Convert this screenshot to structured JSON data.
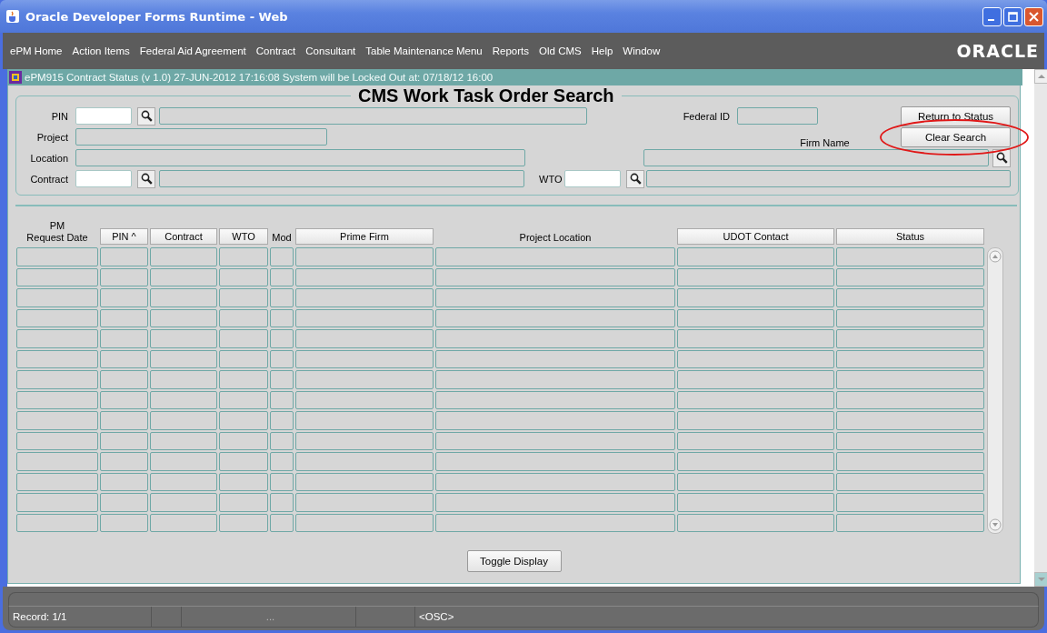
{
  "window": {
    "title": "Oracle Developer Forms Runtime - Web"
  },
  "menu": [
    {
      "label": "ePM Home"
    },
    {
      "label": "Action Items"
    },
    {
      "label": "Federal Aid Agreement"
    },
    {
      "label": "Contract"
    },
    {
      "label": "Consultant"
    },
    {
      "label": "Table Maintenance Menu"
    },
    {
      "label": "Reports"
    },
    {
      "label": "Old CMS"
    },
    {
      "label": "Help"
    },
    {
      "label": "Window"
    }
  ],
  "brand": "ORACLE",
  "form": {
    "title": "ePM915 Contract Status (v 1.0) 27-JUN-2012 17:16:08 System will be Locked Out at: 07/18/12 16:00",
    "heading": "CMS Work Task Order Search"
  },
  "search": {
    "pin": {
      "label": "PIN"
    },
    "project": {
      "label": "Project"
    },
    "location": {
      "label": "Location"
    },
    "contract": {
      "label": "Contract"
    },
    "federal_id": {
      "label": "Federal ID"
    },
    "firm_name": {
      "label": "Firm Name"
    },
    "wto": {
      "label": "WTO"
    }
  },
  "buttons": {
    "return": {
      "label": "Return to Status",
      "highlighted": false
    },
    "clear": {
      "label": "Clear Search",
      "highlighted": true
    },
    "toggle": {
      "label": "Toggle Display"
    }
  },
  "table": {
    "columns": [
      {
        "label": "PM\nRequest Date",
        "kind": "label"
      },
      {
        "label": "PIN ^",
        "kind": "button"
      },
      {
        "label": "Contract",
        "kind": "button"
      },
      {
        "label": "WTO",
        "kind": "button"
      },
      {
        "label": "Mod",
        "kind": "label"
      },
      {
        "label": "Prime Firm",
        "kind": "button"
      },
      {
        "label": "Project Location",
        "kind": "label"
      },
      {
        "label": "UDOT Contact",
        "kind": "button"
      },
      {
        "label": "Status",
        "kind": "button"
      }
    ]
  },
  "status_bar": {
    "record": "Record: 1/1",
    "segment": "...",
    "mode": "<OSC>"
  }
}
